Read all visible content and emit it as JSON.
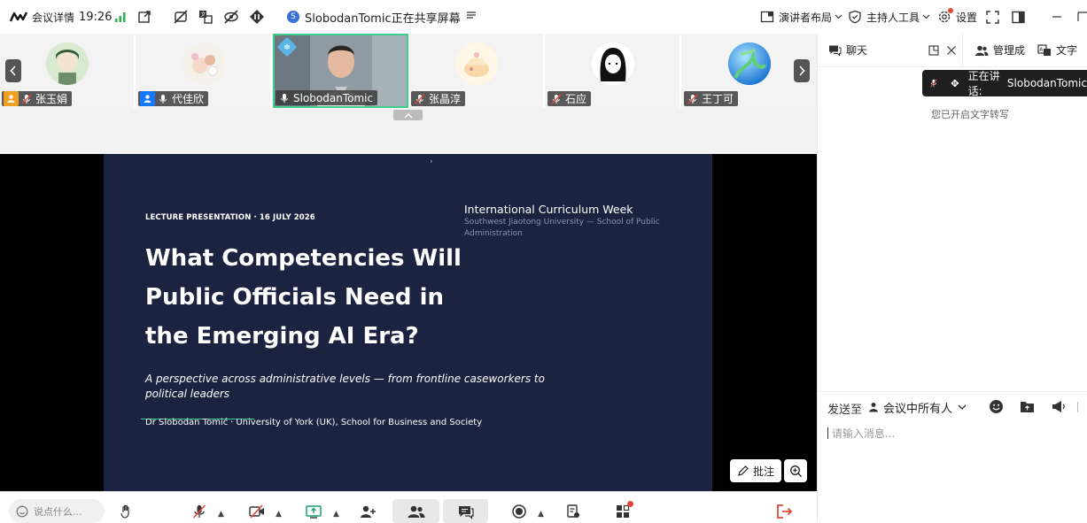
{
  "topbar": {
    "meeting_info": "会议详情",
    "time": "19:26",
    "share_status": "SlobodanTomic正在共享屏幕",
    "sharer_initial": "S",
    "presenter_layout": "演讲者布局",
    "host_tools": "主持人工具",
    "settings": "设置"
  },
  "participants": [
    {
      "name": "张玉娟",
      "role": "host"
    },
    {
      "name": "代佳欣",
      "role": "cohost"
    },
    {
      "name": "SlobodanTomic",
      "role": "speaker"
    },
    {
      "name": "张晶淳",
      "role": "none"
    },
    {
      "name": "石应",
      "role": "none"
    },
    {
      "name": "王丁可",
      "role": "none"
    }
  ],
  "slide": {
    "eyebrow": "LECTURE PRESENTATION · 16 JULY 2026",
    "event_title": "International Curriculum Week",
    "event_sub_1": "Southwest Jiaotong University — School of Public",
    "event_sub_2": "Administration",
    "title_1": "What Competencies Will",
    "title_2": "Public Officials Need in",
    "title_3": "the Emerging AI Era?",
    "subtitle_1": "A perspective across administrative levels — from frontline caseworkers to",
    "subtitle_2": "political leaders",
    "author": "Dr Slobodan Tomić",
    "affiliation": "· University of York (UK), School for Business and Society",
    "marker": "›"
  },
  "stage_tools": {
    "annotate": "批注"
  },
  "bottombar": {
    "say_something": "说点什么..."
  },
  "panel": {
    "tab_chat": "聊天",
    "tab_manage": "管理成",
    "tab_text": "文字",
    "speaking_label": "正在讲话:",
    "speaking_name": "SlobodanTomic",
    "transcript_notice": "您已开启文字转写",
    "send_to_label": "发送至",
    "send_to_value": "会议中所有人",
    "input_placeholder": "请输入消息..."
  },
  "colors": {
    "slide_bg": "#1b2340",
    "accent_green": "#3ecf8e",
    "danger": "#e0493a",
    "blue": "#1677ff"
  }
}
